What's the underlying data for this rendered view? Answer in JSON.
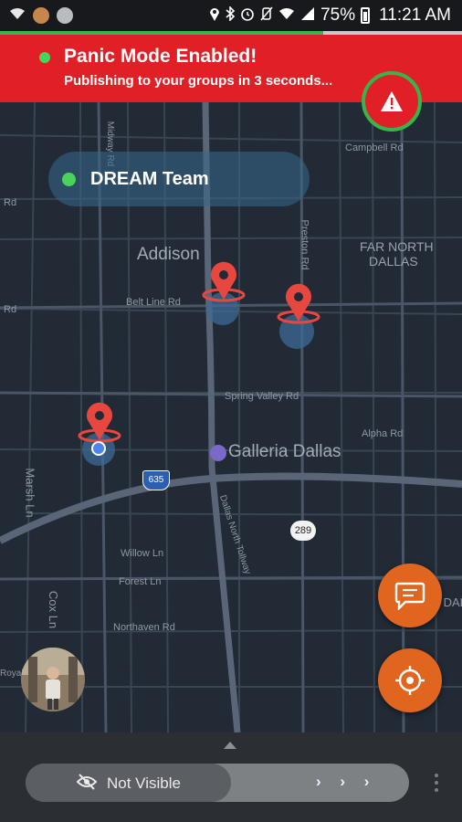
{
  "status_bar": {
    "battery": "75%",
    "time": "11:21 AM",
    "left_icons": [
      "wifi-icon",
      "app-notification-icon",
      "spotify-icon"
    ],
    "right_icons": [
      "location-icon",
      "bluetooth-icon",
      "alarm-icon",
      "mute-icon",
      "wifi-icon",
      "signal-icon",
      "battery-icon"
    ]
  },
  "countdown_progress": 0.7,
  "banner": {
    "title": "Panic Mode Enabled!",
    "subtitle": "Publishing to your groups in 3 seconds...",
    "colors": {
      "background": "#e11f26",
      "indicator": "#4ad35a"
    }
  },
  "panic_button": {
    "icon": "warning-icon",
    "ring_color": "#38b54a"
  },
  "group": {
    "name": "DREAM Team",
    "status_color": "#4ad35a"
  },
  "map": {
    "labels": {
      "addison": "Addison",
      "far_north": "FAR NORTH",
      "dallas": "DALLAS",
      "belt_line": "Belt Line Rd",
      "spring_valley": "Spring Valley Rd",
      "galleria": "Galleria Dallas",
      "alpha": "Alpha Rd",
      "marsh": "Marsh Ln",
      "willow": "Willow Ln",
      "forest": "Forest Ln",
      "northaven": "Northaven Rd",
      "cox": "Cox Ln",
      "preston": "Preston Rd",
      "campbell": "Campbell Rd",
      "dnt": "Dallas North Tollway",
      "midway": "Midway Rd",
      "rd_left1": "Rd",
      "rd_left2": "Rd",
      "royal": "Royal Ln",
      "north_dallas": "NORTH DALLAS",
      "i635": "635",
      "hwy289": "289"
    },
    "colors": {
      "background": "#212a35",
      "road": "#3d4756",
      "marker": "#e8473f",
      "halo": "#3d6b96"
    }
  },
  "actions": {
    "chat_icon": "chat-icon",
    "locate_icon": "crosshair-icon",
    "accent": "#e0651e"
  },
  "visibility": {
    "label": "Not Visible",
    "icon": "eye-off-icon",
    "arrows": "› › ›"
  }
}
